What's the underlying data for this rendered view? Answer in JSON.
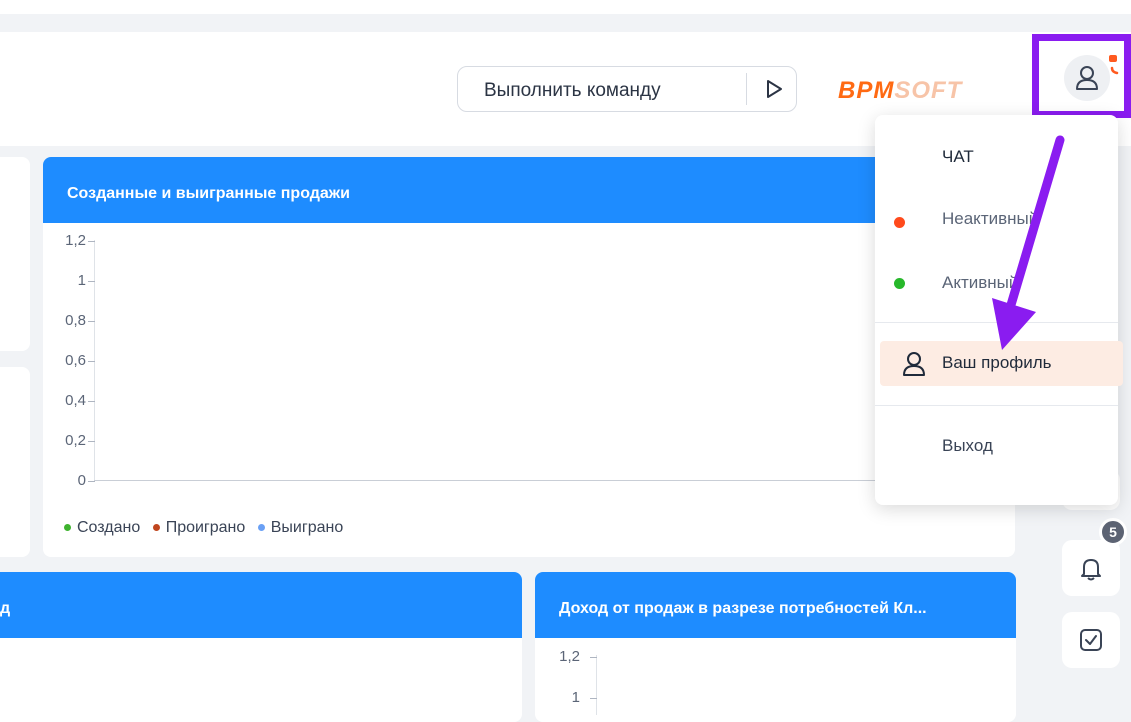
{
  "header": {
    "command_label": "Выполнить команду",
    "logo_part1": "BPM",
    "logo_part2": "SOFT"
  },
  "colors": {
    "accent": "#1e8cff",
    "brand_orange": "#ff6a13",
    "highlight": "#8a1cf0"
  },
  "chart_card": {
    "title": "Созданные и выигранные продажи",
    "chart_data": {
      "type": "line",
      "title": "Созданные и выигранные продажи",
      "y_ticks": [
        "1,2",
        "1",
        "0,8",
        "0,6",
        "0,4",
        "0,2",
        "0"
      ],
      "ylim": [
        0,
        1.2
      ],
      "series": [
        {
          "name": "Создано",
          "values": []
        },
        {
          "name": "Проиграно",
          "values": []
        },
        {
          "name": "Выиграно",
          "values": []
        }
      ],
      "legend_position": "bottom-left"
    },
    "legend": [
      {
        "label": "Создано",
        "color": "#3fb32f"
      },
      {
        "label": "Проиграно",
        "color": "#c0461e"
      },
      {
        "label": "Выиграно",
        "color": "#6aa0f5"
      }
    ]
  },
  "bottom_left_card": {
    "title": "д"
  },
  "bottom_right_card": {
    "title": "Доход от продаж в разрезе потребностей Кл...",
    "y_ticks": [
      "1,2",
      "1"
    ]
  },
  "notifications": {
    "count": "5"
  },
  "profile_menu": {
    "section_title": "ЧАТ",
    "status_inactive": "Неактивный",
    "status_active": "Активный",
    "profile_label": "Ваш профиль",
    "logout_label": "Выход"
  }
}
